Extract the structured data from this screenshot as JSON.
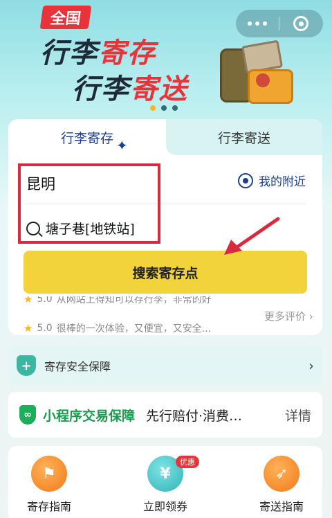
{
  "banner": {
    "tag": "全国",
    "line1_dark": "行李",
    "line1_red": "寄存",
    "line2_dark": "行李",
    "line2_red": "寄送",
    "carousel_dots": 3,
    "active_dot": 1
  },
  "tabs": [
    {
      "label": "行李寄存",
      "active": true
    },
    {
      "label": "行李寄送",
      "active": false
    }
  ],
  "search": {
    "city": "昆明",
    "nearby_label": "我的附近",
    "location_value": "塘子巷[地铁站]",
    "button_label": "搜索寄存点"
  },
  "reviews": {
    "items": [
      {
        "score": "5.0",
        "text": "从网站上得知可以存行李，非常的好"
      },
      {
        "score": "5.0",
        "text": "很棒的一次体验，又便宜，又安全..."
      }
    ],
    "more_label": "更多评价"
  },
  "safety": {
    "label": "寄存安全保障"
  },
  "guarantee": {
    "title": "小程序交易保障",
    "description": "先行赔付·消费…",
    "detail_label": "详情"
  },
  "shortcuts": [
    {
      "label": "寄存指南",
      "icon": "signpost-icon"
    },
    {
      "label": "立即领券",
      "icon": "ticket-icon",
      "badge": "优惠"
    },
    {
      "label": "寄送指南",
      "icon": "compass-icon"
    }
  ],
  "colors": {
    "accent_blue": "#1a3f8f",
    "brand_red": "#e8333a",
    "button_yellow": "#f3d33b",
    "highlight_red": "#d8293f",
    "green": "#1c9a50"
  }
}
